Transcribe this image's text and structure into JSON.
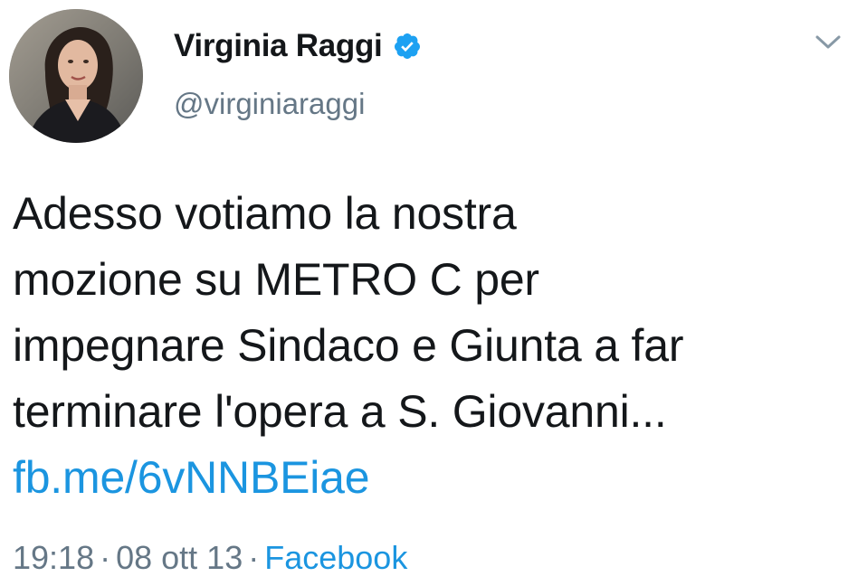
{
  "user": {
    "display_name": "Virginia Raggi",
    "handle": "@virginiaraggi",
    "verified": true,
    "avatar_icon": "profile-photo"
  },
  "tweet": {
    "text_lines": [
      "Adesso votiamo la nostra",
      "mozione su METRO C per",
      "impegnare Sindaco e Giunta a far",
      "terminare l'opera a S. Giovanni..."
    ],
    "link": "fb.me/6vNNBEiae"
  },
  "meta": {
    "time": "19:18",
    "separator": "·",
    "date": "08 ott 13",
    "source": "Facebook"
  },
  "icons": {
    "verified": "verified-badge-icon",
    "menu": "chevron-down-icon"
  },
  "colors": {
    "text": "#14171a",
    "secondary": "#657786",
    "link": "#1b95e0",
    "verified": "#1da1f2"
  }
}
